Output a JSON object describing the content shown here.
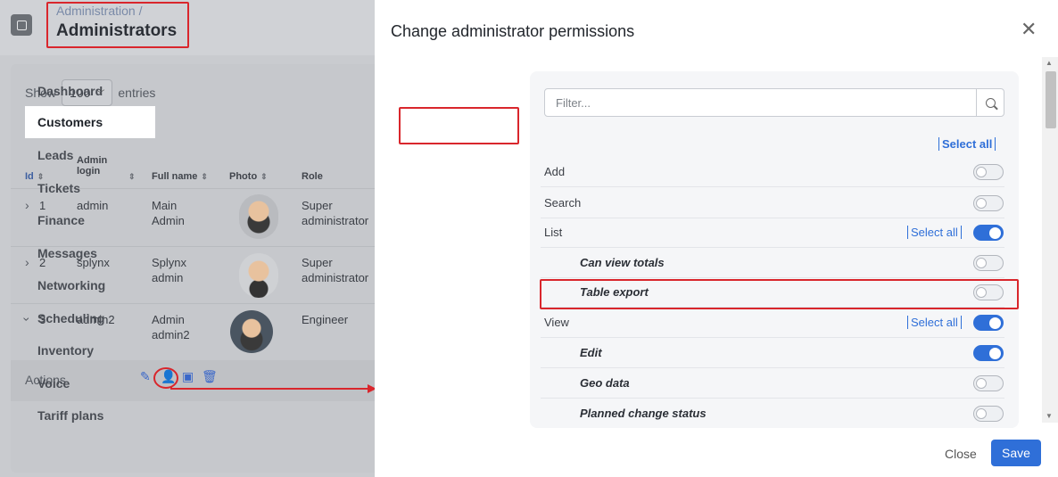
{
  "background": {
    "breadcrumb": "Administration /",
    "title": "Administrators",
    "show_label": "Show",
    "entries_value": "100",
    "entries_label": "entries",
    "columns": {
      "id": "Id",
      "admin_login": "Admin login",
      "full_name": "Full name",
      "photo": "Photo",
      "role": "Role"
    },
    "rows": [
      {
        "id": "1",
        "login": "admin",
        "name": "Main Admin",
        "role": "Super administrator",
        "expanded": false
      },
      {
        "id": "2",
        "login": "splynx",
        "name": "Splynx admin",
        "role": "Super administrator",
        "expanded": false
      },
      {
        "id": "3",
        "login": "admin2",
        "name": "Admin admin2",
        "role": "Engineer",
        "expanded": true
      }
    ],
    "actions_label": "Actions",
    "action_icons": [
      "pencil-icon",
      "user-lock-icon",
      "id-card-icon",
      "trash-icon"
    ]
  },
  "modal": {
    "title": "Change administrator permissions",
    "close_glyph": "✕",
    "tabs": [
      "Dashboard",
      "Customers",
      "Leads",
      "Tickets",
      "Finance",
      "Messages",
      "Networking",
      "Scheduling",
      "Inventory",
      "Voice",
      "Tariff plans"
    ],
    "active_tab": "Customers",
    "filter_placeholder": "Filter...",
    "select_all_label": "Select all",
    "permissions": [
      {
        "label": "Add",
        "enabled": false,
        "sub": false,
        "select_all": false
      },
      {
        "label": "Search",
        "enabled": false,
        "sub": false,
        "select_all": false
      },
      {
        "label": "List",
        "enabled": true,
        "sub": false,
        "select_all": true
      },
      {
        "label": "Can view totals",
        "enabled": false,
        "sub": true,
        "select_all": false
      },
      {
        "label": "Table export",
        "enabled": false,
        "sub": true,
        "select_all": false
      },
      {
        "label": "View",
        "enabled": true,
        "sub": false,
        "select_all": true
      },
      {
        "label": "Edit",
        "enabled": true,
        "sub": true,
        "select_all": false
      },
      {
        "label": "Geo data",
        "enabled": false,
        "sub": true,
        "select_all": false
      },
      {
        "label": "Planned change status",
        "enabled": false,
        "sub": true,
        "select_all": false
      }
    ],
    "footer": {
      "close_label": "Close",
      "save_label": "Save"
    }
  },
  "colors": {
    "accent": "#2f6fd8",
    "annotation_red": "#d9262c"
  }
}
